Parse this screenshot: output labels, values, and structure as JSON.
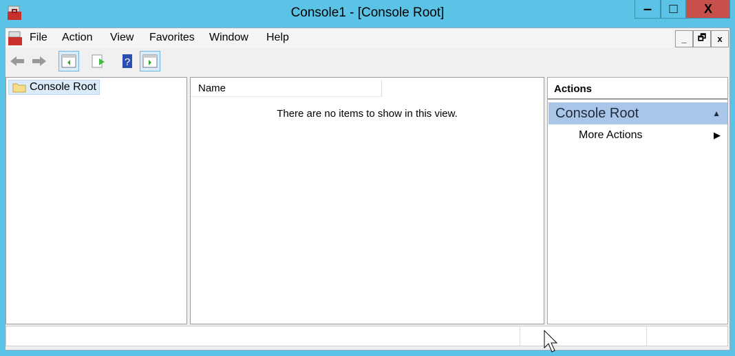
{
  "window": {
    "title": "Console1 - [Console Root]",
    "minimize": "–",
    "maximize": "□",
    "close": "X"
  },
  "menu": {
    "items": [
      "File",
      "Action",
      "View",
      "Favorites",
      "Window",
      "Help"
    ],
    "mdi_minimize": "_",
    "mdi_restore": "🗗",
    "mdi_close": "x"
  },
  "tree": {
    "root": "Console Root"
  },
  "list": {
    "column_name": "Name",
    "empty_message": "There are no items to show in this view."
  },
  "actions": {
    "header": "Actions",
    "section": "Console Root",
    "items": [
      "More Actions"
    ]
  }
}
